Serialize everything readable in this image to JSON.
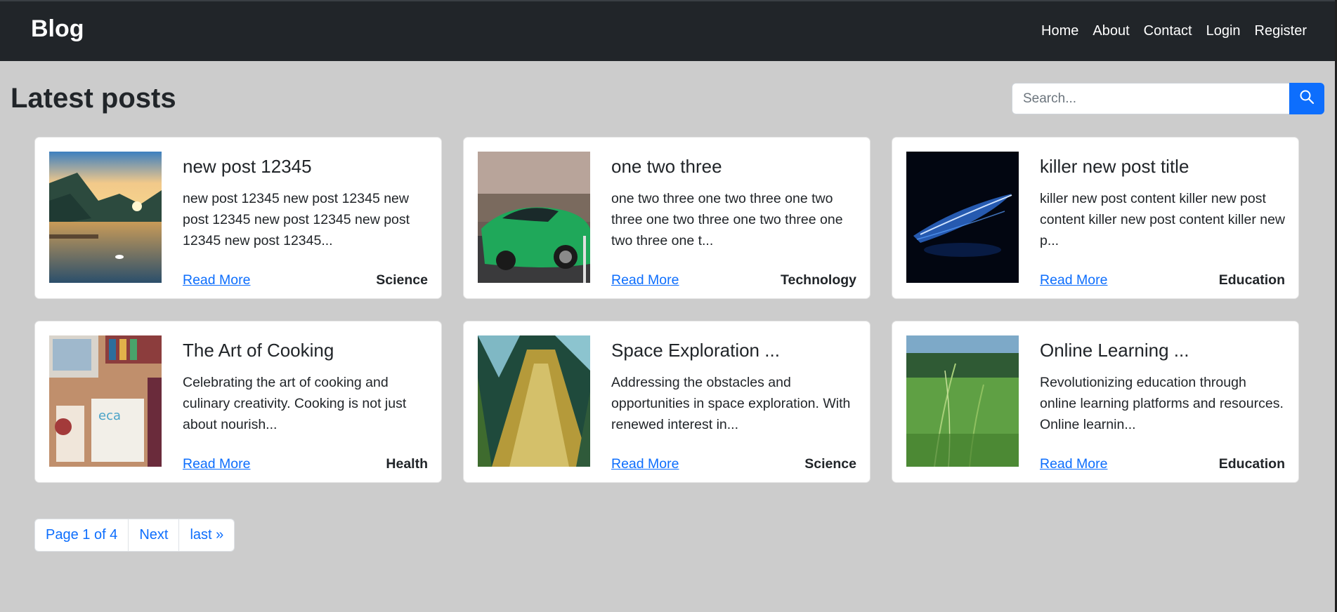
{
  "navbar": {
    "brand": "Blog",
    "links": [
      "Home",
      "About",
      "Contact",
      "Login",
      "Register"
    ]
  },
  "main": {
    "title": "Latest posts",
    "search": {
      "placeholder": "Search...",
      "value": ""
    }
  },
  "posts": [
    {
      "title": "new post 12345",
      "excerpt": "new post 12345 new post 12345 new post 12345 new post 12345 new post 12345 new post 12345...",
      "read_more": "Read More",
      "category": "Science",
      "image": "mountain-lake-sunset-image"
    },
    {
      "title": "one two three",
      "excerpt": "one two three one two three one two three one two three one two three one two three one t...",
      "read_more": "Read More",
      "category": "Technology",
      "image": "green-sports-car-image"
    },
    {
      "title": "killer new post title",
      "excerpt": "killer new post content killer new post content killer new post content killer new p...",
      "read_more": "Read More",
      "category": "Education",
      "image": "glowing-blue-feather-image"
    },
    {
      "title": "The Art of Cooking",
      "excerpt": "Celebrating the art of cooking and culinary creativity. Cooking is not just about nourish...",
      "read_more": "Read More",
      "category": "Health",
      "image": "desk-workspace-image"
    },
    {
      "title": "Space Exploration ...",
      "excerpt": "Addressing the obstacles and opportunities in space exploration. With renewed interest in...",
      "read_more": "Read More",
      "category": "Science",
      "image": "tree-trunk-image"
    },
    {
      "title": "Online Learning ...",
      "excerpt": "Revolutionizing education through online learning platforms and resources. Online learnin...",
      "read_more": "Read More",
      "category": "Education",
      "image": "green-grass-field-image"
    }
  ],
  "pagination": {
    "current": "Page 1 of 4",
    "next": "Next",
    "last": "last »"
  },
  "colors": {
    "navbar": "#212529",
    "background": "#cccccc",
    "accent": "#0d6efd",
    "card": "#ffffff"
  }
}
